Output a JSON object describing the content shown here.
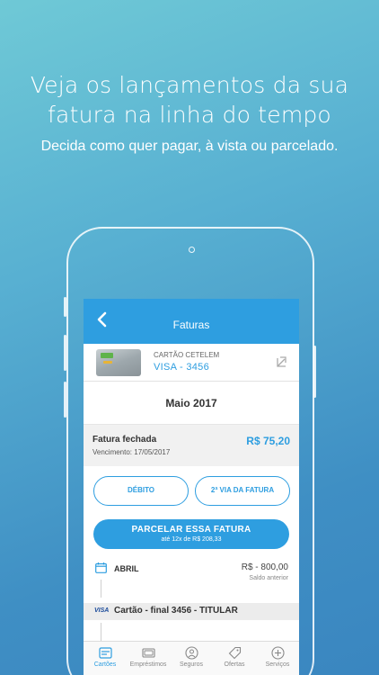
{
  "promo": {
    "headline_line1": "Veja os lançamentos da sua",
    "headline_line2": "fatura na linha do tempo",
    "subline": "Decida como quer pagar, à vista ou parcelado."
  },
  "app": {
    "header_title": "Faturas",
    "card": {
      "name": "CARTÃO CETELEM",
      "number": "VISA - 3456"
    },
    "month": "Maio 2017",
    "invoice": {
      "status": "Fatura fechada",
      "due": "Vencimento: 17/05/2017",
      "amount": "R$ 75,20"
    },
    "buttons": {
      "debit": "DÉBITO",
      "second_copy": "2ª VIA DA FATURA",
      "installments": "PARCELAR ESSA  FATURA",
      "installments_sub": "até 12x de R$ 208,33"
    },
    "timeline": {
      "month": "ABRIL",
      "amount": "R$ - 800,00",
      "amount_label": "Saldo anterior",
      "card_brand": "VISA",
      "card_line": "Cartão - final 3456 - TITULAR"
    },
    "tabs": [
      {
        "label": "Cartões",
        "icon": "card-icon",
        "active": true
      },
      {
        "label": "Empréstimos",
        "icon": "money-icon",
        "active": false
      },
      {
        "label": "Seguros",
        "icon": "shield-person-icon",
        "active": false
      },
      {
        "label": "Ofertas",
        "icon": "tag-icon",
        "active": false
      },
      {
        "label": "Serviços",
        "icon": "plus-circle-icon",
        "active": false
      }
    ]
  },
  "colors": {
    "accent": "#2e9ee0",
    "background_top": "#6fc9d6",
    "background_bottom": "#3a86c0"
  }
}
